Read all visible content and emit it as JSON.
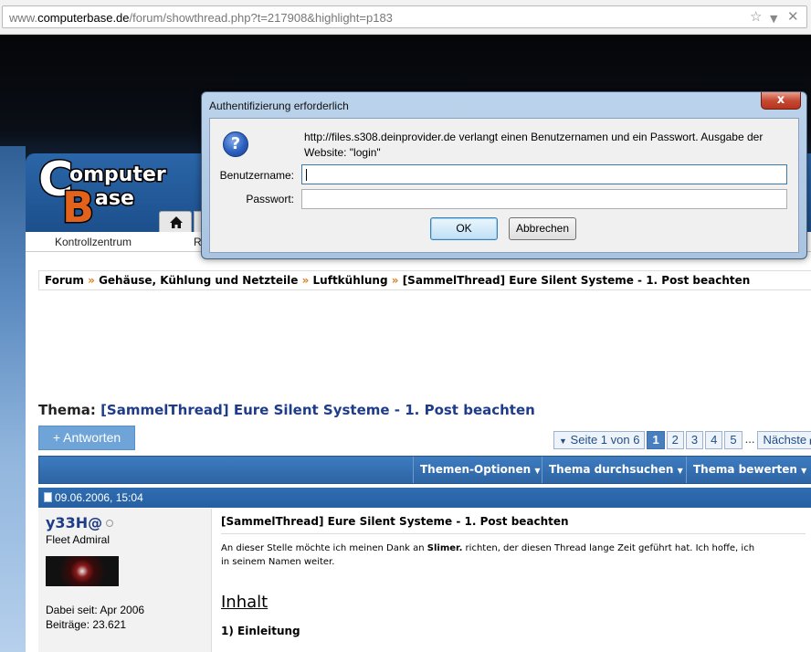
{
  "browser": {
    "url_host": "www.computerbase.de",
    "url_path": "/forum/showthread.php?t=217908&highlight=p183",
    "url_prefix": "www.",
    "url_domain": "computerbase.de",
    "icons": [
      "star-icon",
      "dropdown-arrow-icon",
      "close-icon"
    ]
  },
  "site": {
    "logo_line1": "omputer",
    "logo_letter_c": "C",
    "logo_letter_b": "B",
    "logo_line2": "ase",
    "nav": {
      "kontrollzentrum": "Kontrollzentrum",
      "partial": "R"
    }
  },
  "breadcrumb": {
    "items": [
      "Forum",
      "Gehäuse, Kühlung und Netzteile",
      "Luftkühlung",
      "[SammelThread] Eure Silent Systeme - 1. Post beachten"
    ],
    "separator": "»"
  },
  "thread": {
    "label": "Thema:",
    "title": "[SammelThread] Eure Silent Systeme - 1. Post beachten",
    "reply_button": "+ Antworten"
  },
  "pager": {
    "summary": "Seite 1 von 6",
    "pages": [
      "1",
      "2",
      "3",
      "4",
      "5"
    ],
    "current": "1",
    "dots": "...",
    "next": "Nächste"
  },
  "options": {
    "themen_optionen": "Themen-Optionen",
    "thema_durchsuchen": "Thema durchsuchen",
    "thema_bewerten": "Thema bewerten"
  },
  "post": {
    "date": "09.06.2006, 15:04",
    "username": "y33H@",
    "user_title": "Fleet Admiral",
    "joined": "Dabei seit: Apr 2006",
    "posts": "Beiträge: 23.621",
    "title": "[SammelThread] Eure Silent Systeme - 1. Post beachten",
    "text_before": "An dieser Stelle möchte ich meinen Dank an ",
    "text_bold": "Slimer.",
    "text_after": " richten, der diesen Thread lange Zeit geführt hat. Ich hoffe, ich",
    "text_line2": "in seinem Namen weiter.",
    "heading": "Inhalt",
    "section1": "1) Einleitung"
  },
  "dialog": {
    "title": "Authentifizierung erforderlich",
    "close": "x",
    "message": "http://files.s308.deinprovider.de verlangt einen Benutzernamen und ein Passwort. Ausgabe der Website: \"login\"",
    "username_label": "Benutzername:",
    "password_label": "Passwort:",
    "username_value": "",
    "password_value": "",
    "ok": "OK",
    "cancel": "Abbrechen",
    "icon": "question-icon"
  }
}
